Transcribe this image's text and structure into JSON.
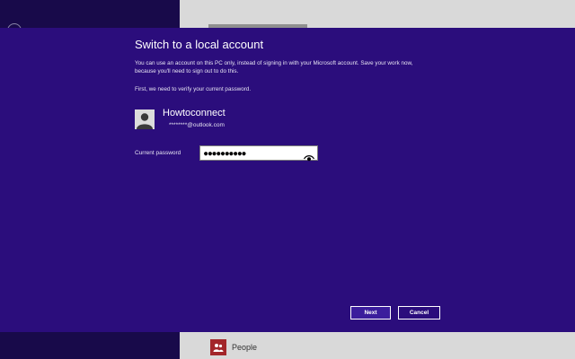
{
  "background": {
    "people_tile_label": "People"
  },
  "dialog": {
    "title": "Switch to a local account",
    "description": "You can use an account on this PC only, instead of signing in with your Microsoft account. Save your work now, because you'll need to sign out to do this.",
    "verify_prompt": "First, we need to verify your current password.",
    "account_name": "Howtoconnect",
    "account_email": "********@outlook.com",
    "password_label": "Current password",
    "password_value": "●●●●●●●●●●",
    "next_label": "Next",
    "cancel_label": "Cancel"
  },
  "colors": {
    "dialog_background": "#2b0d7c",
    "left_pane": "#180a4a",
    "right_pane": "#d9d9d9",
    "people_tile": "#a3262a",
    "next_button_fill": "#3b1d9c"
  },
  "icons": {
    "avatar": "user-silhouette-icon",
    "reveal_password": "eye-icon",
    "people_tile": "people-icon",
    "back": "back-arrow-icon"
  }
}
